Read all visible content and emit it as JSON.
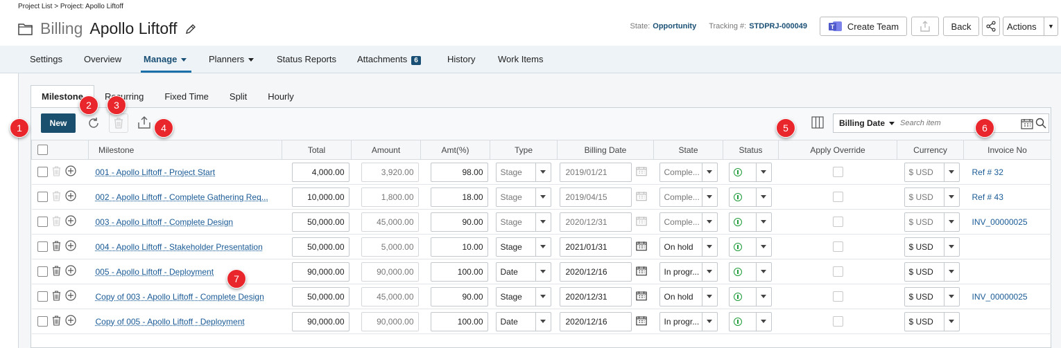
{
  "header": {
    "breadcrumb": "Project List > Project: Apollo Liftoff",
    "title_prefix": "Billing",
    "title_name": "Apollo Liftoff",
    "state_label": "State:",
    "state_value": "Opportunity",
    "tracking_label": "Tracking #:",
    "tracking_value": "STDPRJ-000049",
    "create_team_label": "Create Team",
    "back_label": "Back",
    "actions_label": "Actions"
  },
  "nav": {
    "settings": "Settings",
    "overview": "Overview",
    "manage": "Manage",
    "planners": "Planners",
    "status_reports": "Status Reports",
    "attachments": "Attachments",
    "attachments_count": "6",
    "history": "History",
    "work_items": "Work Items"
  },
  "subtabs": {
    "milestone": "Milestone",
    "recurring": "Recurring",
    "fixed_time": "Fixed Time",
    "split": "Split",
    "hourly": "Hourly"
  },
  "toolbar": {
    "new_label": "New",
    "search_field": "Billing Date",
    "search_placeholder": "Search item"
  },
  "columns": {
    "milestone": "Milestone",
    "total": "Total",
    "amount": "Amount",
    "amt_pct": "Amt(%)",
    "type": "Type",
    "billing_date": "Billing Date",
    "state": "State",
    "status": "Status",
    "apply_override": "Apply Override",
    "currency": "Currency",
    "invoice_no": "Invoice No"
  },
  "rows": [
    {
      "milestone": "001 - Apollo Liftoff - Project Start",
      "total": "4,000.00",
      "amount": "3,920.00",
      "pct": "98.00",
      "type": "Stage",
      "date": "2019/01/21",
      "state": "Comple...",
      "currency": "$ USD",
      "invoice": "Ref # 32"
    },
    {
      "milestone": "002 - Apollo Liftoff - Complete Gathering Req...",
      "total": "10,000.00",
      "amount": "1,800.00",
      "pct": "18.00",
      "type": "Stage",
      "date": "2019/04/15",
      "state": "Comple...",
      "currency": "$ USD",
      "invoice": "Ref # 43"
    },
    {
      "milestone": "003 - Apollo Liftoff - Complete Design",
      "total": "50,000.00",
      "amount": "45,000.00",
      "pct": "90.00",
      "type": "Stage",
      "date": "2020/12/31",
      "state": "Comple...",
      "currency": "$ USD",
      "invoice": "INV_00000025"
    },
    {
      "milestone": "004 - Apollo Liftoff - Stakeholder Presentation",
      "total": "50,000.00",
      "amount": "5,000.00",
      "pct": "10.00",
      "type": "Stage",
      "date": "2021/01/31",
      "state": "On hold",
      "currency": "$ USD",
      "invoice": ""
    },
    {
      "milestone": "005 - Apollo Liftoff - Deployment",
      "total": "90,000.00",
      "amount": "90,000.00",
      "pct": "100.00",
      "type": "Date",
      "date": "2020/12/16",
      "state": "In progr...",
      "currency": "$ USD",
      "invoice": ""
    },
    {
      "milestone": "Copy of 003 - Apollo Liftoff - Complete Design",
      "total": "50,000.00",
      "amount": "45,000.00",
      "pct": "90.00",
      "type": "Stage",
      "date": "2020/12/31",
      "state": "On hold",
      "currency": "$ USD",
      "invoice": "INV_00000025"
    },
    {
      "milestone": "Copy of 005 - Apollo Liftoff - Deployment",
      "total": "90,000.00",
      "amount": "90,000.00",
      "pct": "100.00",
      "type": "Date",
      "date": "2020/12/16",
      "state": "In progr...",
      "currency": "$ USD",
      "invoice": ""
    }
  ],
  "callouts": [
    "1",
    "2",
    "3",
    "4",
    "5",
    "6",
    "7"
  ],
  "colors": {
    "accent": "#1a4f75",
    "callout": "#e8262b",
    "status_green": "#1e9b3a",
    "link": "#1a5a96"
  }
}
